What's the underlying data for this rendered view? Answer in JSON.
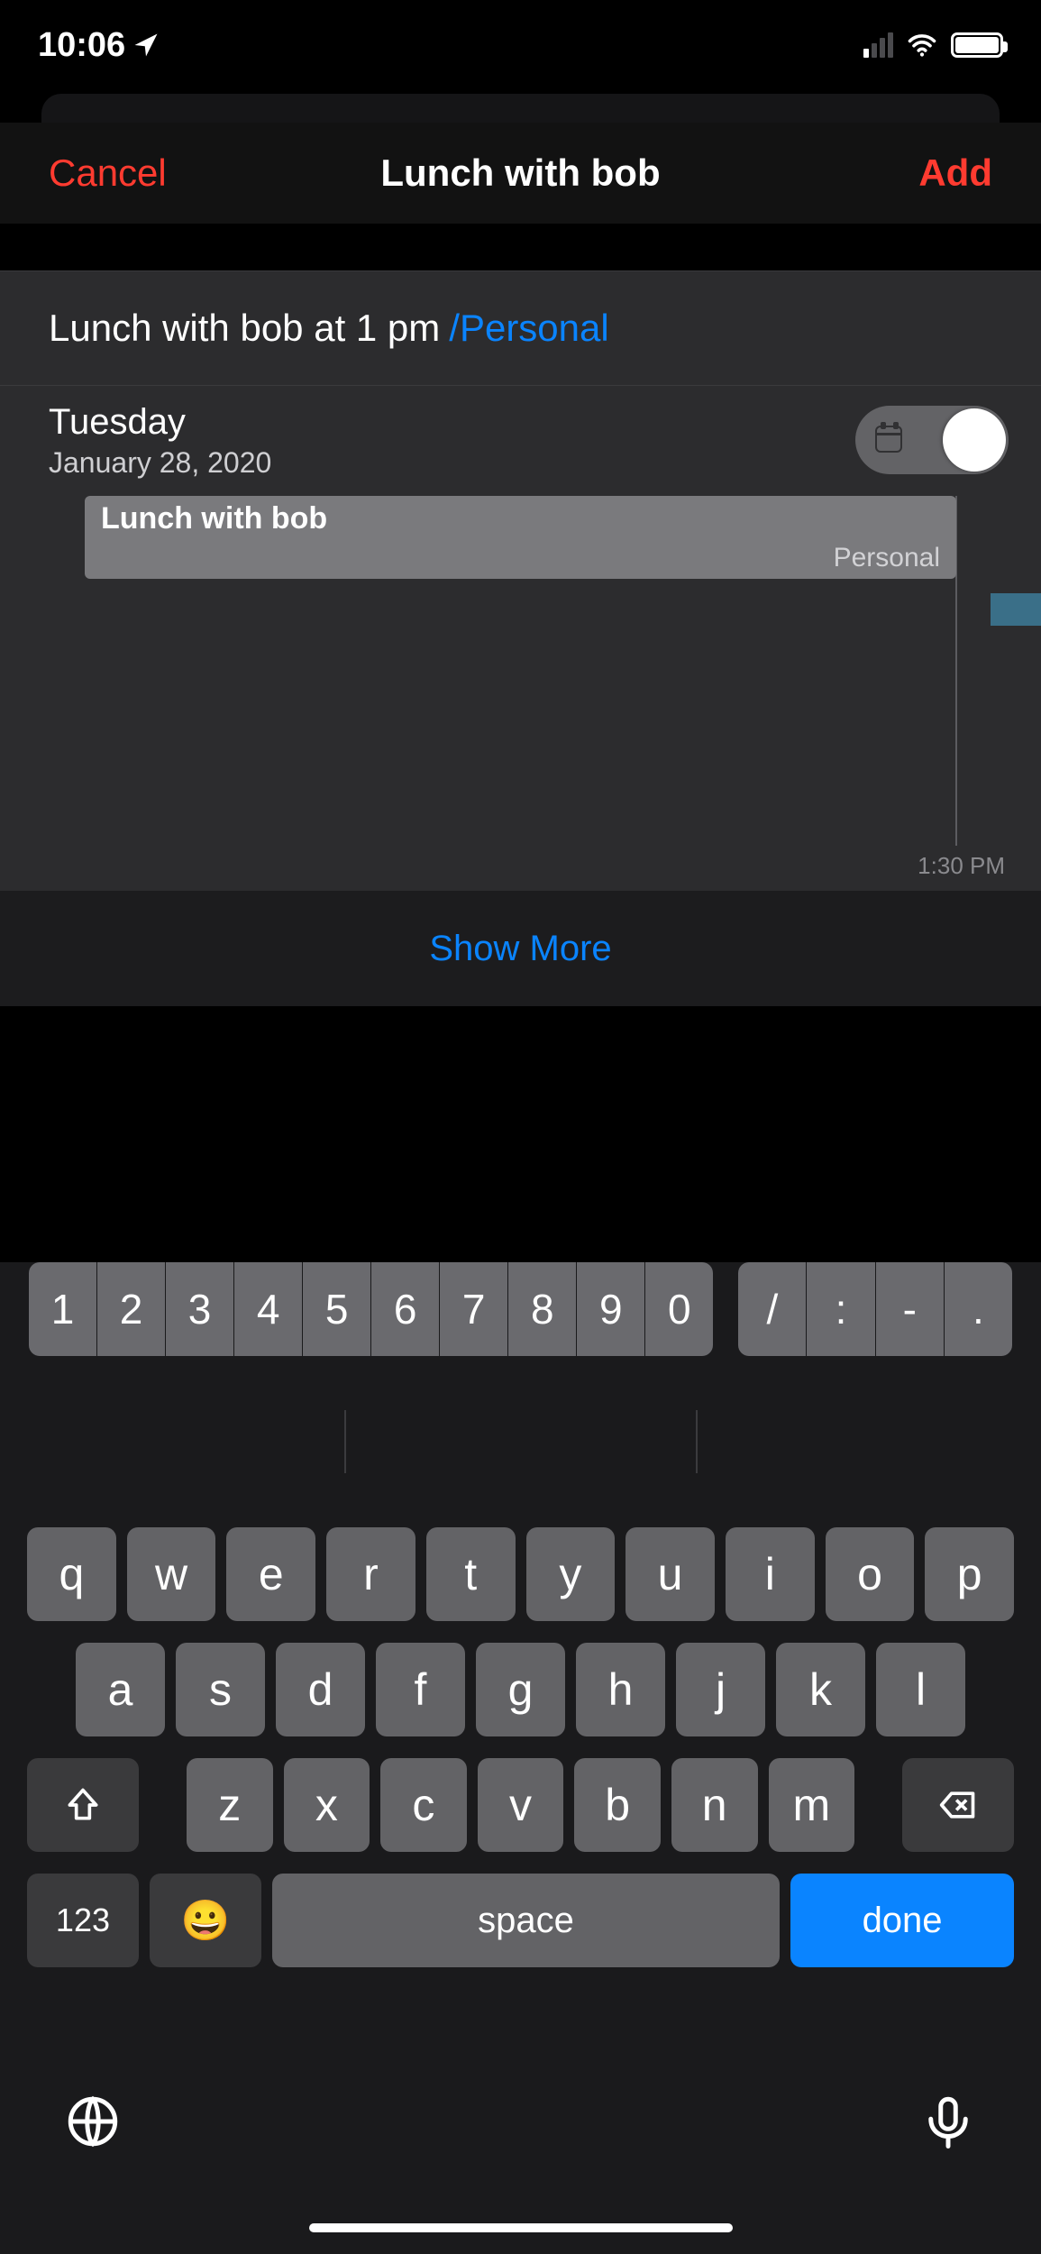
{
  "status": {
    "time": "10:06",
    "location_icon": "location-arrow-icon",
    "wifi_icon": "wifi-icon",
    "battery_level": "full"
  },
  "header": {
    "cancel": "Cancel",
    "title": "Lunch with bob",
    "add": "Add"
  },
  "input": {
    "text": "Lunch with bob at 1 pm",
    "tag": "/Personal"
  },
  "schedule": {
    "day_of_week": "Tuesday",
    "date": "January 28, 2020",
    "toggle_on": true,
    "event": {
      "title": "Lunch with bob",
      "calendar": "Personal"
    },
    "time_label": "1:30 PM"
  },
  "show_more": "Show More",
  "keyboard": {
    "numbers": [
      "1",
      "2",
      "3",
      "4",
      "5",
      "6",
      "7",
      "8",
      "9",
      "0"
    ],
    "symbols": [
      "/",
      ":",
      "-",
      "."
    ],
    "row1": [
      "q",
      "w",
      "e",
      "r",
      "t",
      "y",
      "u",
      "i",
      "o",
      "p"
    ],
    "row2": [
      "a",
      "s",
      "d",
      "f",
      "g",
      "h",
      "j",
      "k",
      "l"
    ],
    "row3": [
      "z",
      "x",
      "c",
      "v",
      "b",
      "n",
      "m"
    ],
    "num_key": "123",
    "emoji_key": "😀",
    "space": "space",
    "done": "done"
  }
}
